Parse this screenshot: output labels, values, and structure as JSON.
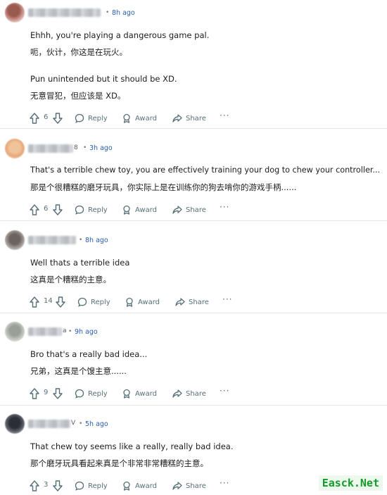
{
  "labels": {
    "reply": "Reply",
    "award": "Award",
    "share": "Share",
    "more": "···",
    "dot": "•"
  },
  "comments": [
    {
      "user_suffix": "",
      "time": "8h ago",
      "lines": [
        "Ehhh, you're playing a dangerous game pal.",
        "呃，伙计，你这是在玩火。",
        "Pun unintended but it should be XD.",
        "无意冒犯，但应该是 XD。"
      ],
      "votes": "6"
    },
    {
      "user_suffix": "8",
      "time": "3h ago",
      "lines": [
        "That's a terrible chew toy, you are effectively training your dog to chew your controller...",
        "那是个很糟糕的磨牙玩具，你实际上是在训练你的狗去啃你的游戏手柄......"
      ],
      "votes": "6"
    },
    {
      "user_suffix": "",
      "time": "8h ago",
      "lines": [
        "Well thats a terrible idea",
        "这真是个糟糕的主意。"
      ],
      "votes": "14"
    },
    {
      "user_suffix": "a",
      "time": "9h ago",
      "lines": [
        "Bro that's a really bad idea...",
        "兄弟，这真是个馊主意......"
      ],
      "votes": "9"
    },
    {
      "user_suffix": "V",
      "time": "5h ago",
      "lines": [
        "That chew toy seems like a really, really bad idea.",
        "那个磨牙玩具看起来真是个非常非常糟糕的主意。"
      ],
      "votes": "3"
    }
  ],
  "watermark": "Easck.Net"
}
